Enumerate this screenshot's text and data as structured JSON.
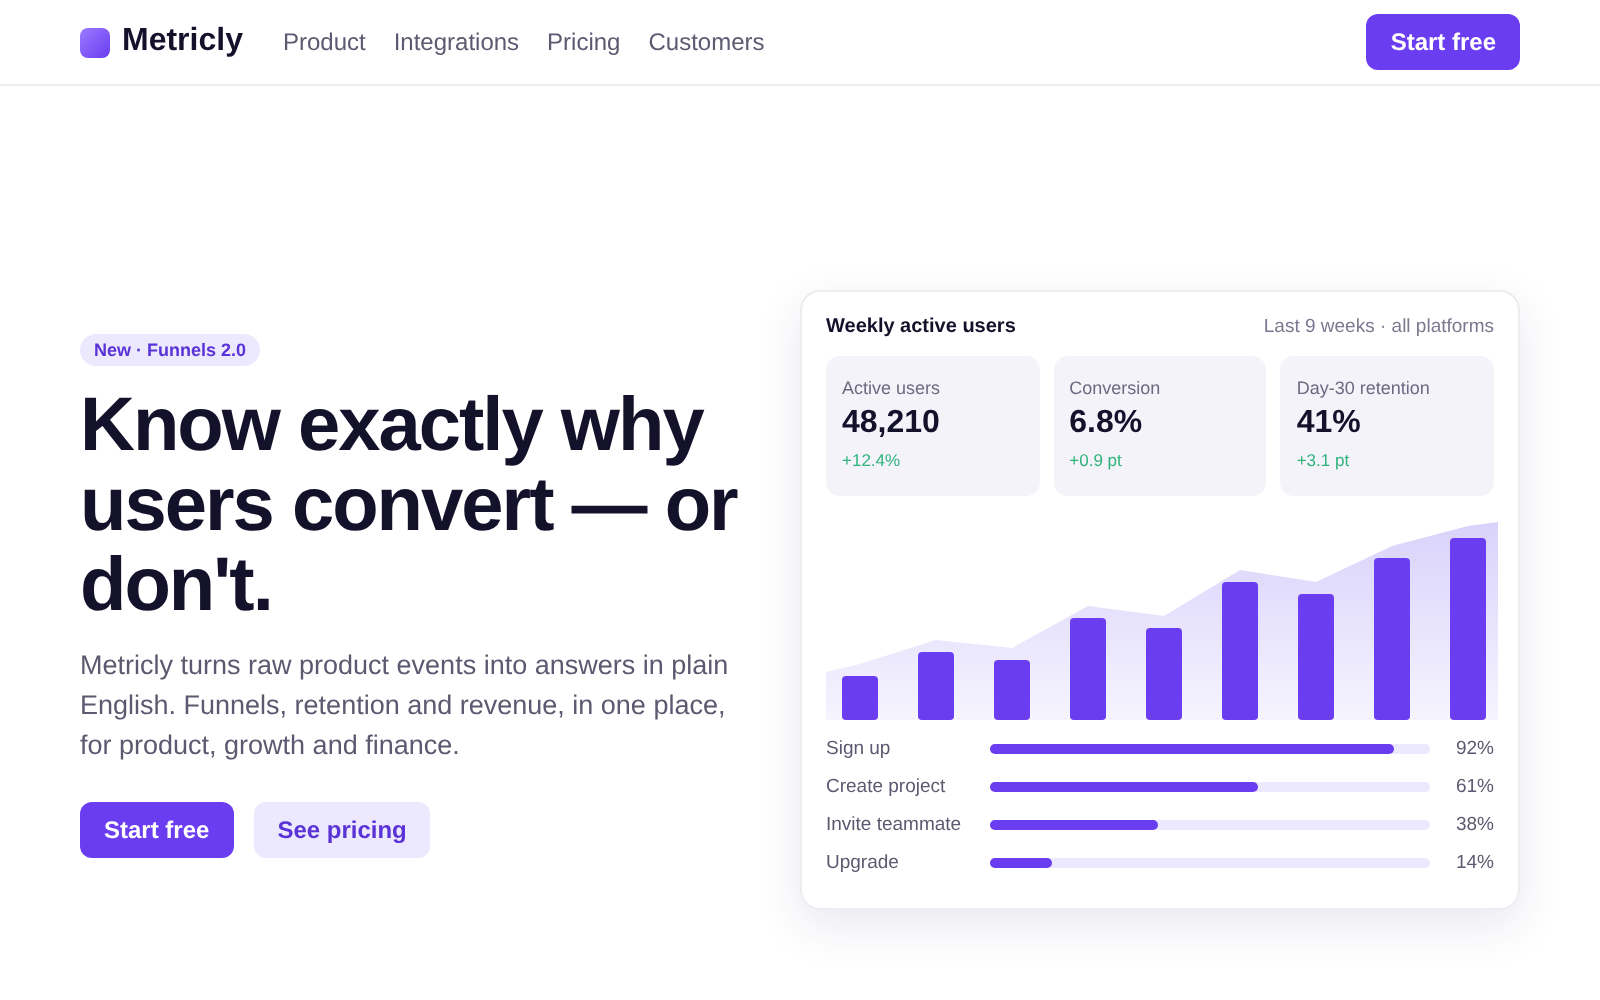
{
  "nav": {
    "brand": "Metricly",
    "links": [
      "Product",
      "Integrations",
      "Pricing",
      "Customers"
    ],
    "cta": "Start free"
  },
  "hero": {
    "badge": "New · Funnels 2.0",
    "headline": "Know exactly why users convert — or don't.",
    "lead": "Metricly turns raw product events into answers in plain English. Funnels, retention and revenue, in one place, for product, growth and finance.",
    "primary": "Start free",
    "secondary": "See pricing"
  },
  "card": {
    "title": "Weekly active users",
    "subtitle": "Last 9 weeks · all platforms",
    "stats": [
      {
        "label": "Active users",
        "value": "48,210",
        "delta": "+12.4%"
      },
      {
        "label": "Conversion",
        "value": "6.8%",
        "delta": "+0.9 pt"
      },
      {
        "label": "Day-30 retention",
        "value": "41%",
        "delta": "+3.1 pt"
      }
    ],
    "funnel": [
      {
        "label": "Sign up",
        "level": 0.92,
        "reading": "92%"
      },
      {
        "label": "Create project",
        "level": 0.61,
        "reading": "61%"
      },
      {
        "label": "Invite teammate",
        "level": 0.38,
        "reading": "38%"
      },
      {
        "label": "Upgrade",
        "level": 0.14,
        "reading": "14%"
      }
    ]
  }
}
